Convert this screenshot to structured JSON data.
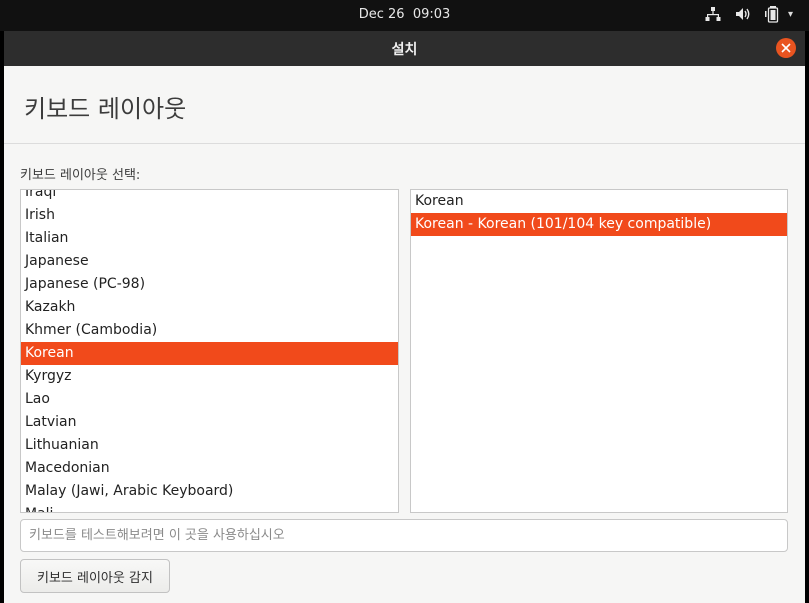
{
  "topbar": {
    "date": "Dec 26",
    "time": "09:03",
    "icons": [
      "network-icon",
      "volume-icon",
      "battery-icon",
      "system-menu-caret-icon"
    ]
  },
  "window": {
    "title": "설치",
    "close_icon": "close-icon",
    "accent_color": "#e95420",
    "selection_color": "#f14a1b"
  },
  "page": {
    "title": "키보드 레이아웃",
    "section_label": "키보드 레이아웃 선택:"
  },
  "layouts": {
    "items": [
      "Iraqi",
      "Irish",
      "Italian",
      "Japanese",
      "Japanese (PC-98)",
      "Kazakh",
      "Khmer (Cambodia)",
      "Korean",
      "Kyrgyz",
      "Lao",
      "Latvian",
      "Lithuanian",
      "Macedonian",
      "Malay (Jawi, Arabic Keyboard)",
      "Mali"
    ],
    "selected": "Korean"
  },
  "variants": {
    "items": [
      "Korean",
      "Korean - Korean (101/104 key compatible)"
    ],
    "selected": "Korean - Korean (101/104 key compatible)"
  },
  "test_input": {
    "placeholder": "키보드를 테스트해보려면 이 곳을 사용하십시오",
    "value": ""
  },
  "detect_button": {
    "label": "키보드 레이아웃 감지"
  }
}
